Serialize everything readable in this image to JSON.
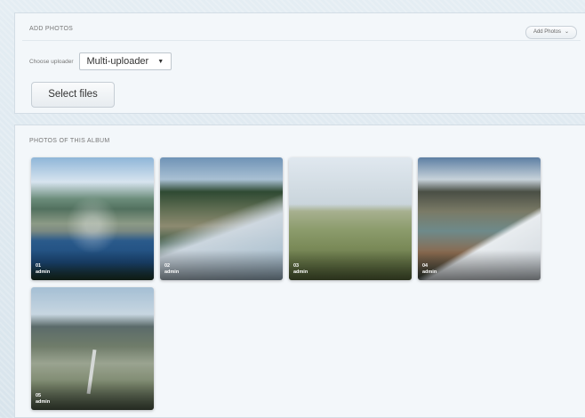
{
  "add_photos_panel": {
    "title": "ADD PHOTOS",
    "add_photos_button": "Add Photos",
    "uploader_label": "Choose uploader",
    "uploader_selected": "Multi-uploader",
    "select_files_label": "Select files"
  },
  "album_panel": {
    "title": "PHOTOS OF THIS ALBUM",
    "photos": [
      {
        "number": "01",
        "user": "admin"
      },
      {
        "number": "02",
        "user": "admin"
      },
      {
        "number": "03",
        "user": "admin"
      },
      {
        "number": "04",
        "user": "admin"
      },
      {
        "number": "05",
        "user": "admin"
      }
    ]
  },
  "icons": {
    "dropdown_chevron": "chevron-down-icon",
    "select_caret": "caret-down-icon"
  }
}
